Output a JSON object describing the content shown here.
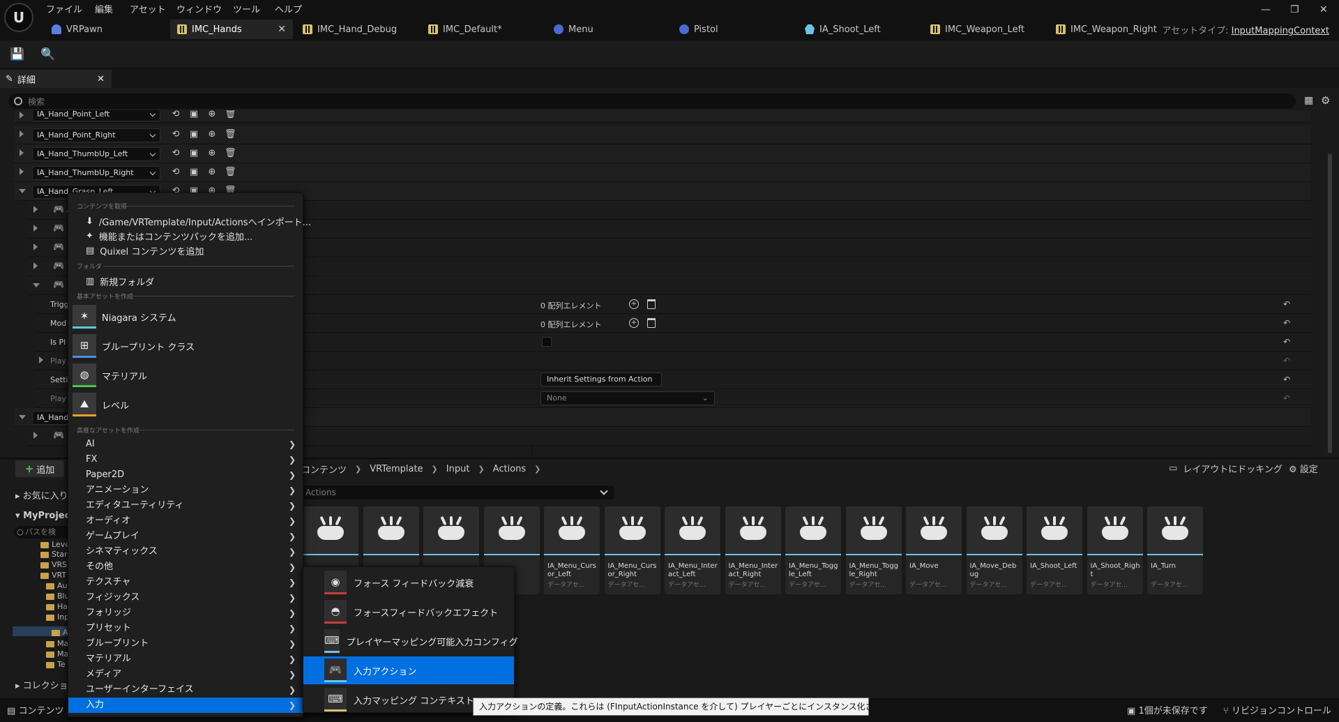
{
  "menubar": [
    "ファイル",
    "編集",
    "アセット",
    "ウィンドウ",
    "ツール",
    "ヘルプ"
  ],
  "tabs": [
    {
      "label": "VRPawn",
      "icon": "pawn-icon"
    },
    {
      "label": "IMC_Hands",
      "icon": "input-mapping-icon",
      "active": true
    },
    {
      "label": "IMC_Hand_Debug",
      "icon": "input-mapping-icon"
    },
    {
      "label": "IMC_Default*",
      "icon": "input-mapping-icon"
    },
    {
      "label": "Menu",
      "icon": "widget-icon"
    },
    {
      "label": "Pistol",
      "icon": "blueprint-icon"
    },
    {
      "label": "IA_Shoot_Left",
      "icon": "input-action-icon"
    },
    {
      "label": "IMC_Weapon_Left",
      "icon": "input-mapping-icon"
    },
    {
      "label": "IMC_Weapon_Right",
      "icon": "input-mapping-icon"
    }
  ],
  "asset_type": {
    "label": "アセットタイプ:",
    "value": "InputMappingContext"
  },
  "details": {
    "tab_label": "詳細",
    "search_placeholder": "検索",
    "mappings": [
      "IA_Hand_Point_Left",
      "IA_Hand_Point_Right",
      "IA_Hand_ThumbUp_Left",
      "IA_Hand_ThumbUp_Right",
      "IA_Hand_Grasp_Left",
      "IA_Hand_Grasp_Right"
    ],
    "sub_prefix": "Au",
    "props": [
      {
        "label": "Trigg",
        "value": "0 配列エレメント"
      },
      {
        "label": "Mod",
        "value": "0 配列エレメント"
      },
      {
        "label": "Is Pl",
        "value": ""
      },
      {
        "label": "Play",
        "value": ""
      },
      {
        "label": "Setti",
        "value": "Inherit Settings from Action"
      },
      {
        "label": "Play",
        "value": "None"
      }
    ]
  },
  "content_browser": {
    "add_label": "追加",
    "favorites_label": "お気に入り",
    "project_label": "MyProject",
    "path_search_placeholder": "パスを検",
    "collections_label": "コレクショ",
    "breadcrumb": [
      "コンテンツ",
      "VRTemplate",
      "Input",
      "Actions"
    ],
    "dock_label": "レイアウトにドッキング",
    "settings_label": "設定",
    "filter_placeholder": "Actions",
    "tree": [
      "Leve",
      "Star",
      "VRS",
      "VRT",
      "Au",
      "Blu",
      "Ha",
      "Inp",
      "A",
      "Ma",
      "Ma",
      "Te"
    ],
    "assets": [
      {
        "name": "",
        "type": ""
      },
      {
        "name": "",
        "type": ""
      },
      {
        "name": "",
        "type": ""
      },
      {
        "name": "",
        "type": ""
      },
      {
        "name": "IA_Menu_Cursor_Left",
        "type": "データアセ..."
      },
      {
        "name": "IA_Menu_Cursor_Right",
        "type": "データアセ..."
      },
      {
        "name": "IA_Menu_Interact_Left",
        "type": "データアセ..."
      },
      {
        "name": "IA_Menu_Interact_Right",
        "type": "データアセ..."
      },
      {
        "name": "IA_Menu_Toggle_Left",
        "type": "データアセ..."
      },
      {
        "name": "IA_Menu_Toggle_Right",
        "type": "データアセ..."
      },
      {
        "name": "IA_Move",
        "type": "データアセ..."
      },
      {
        "name": "IA_Move_Debug",
        "type": "データアセ..."
      },
      {
        "name": "IA_Shoot_Left",
        "type": "データアセ..."
      },
      {
        "name": "IA_Shoot_Right",
        "type": "データアセ..."
      },
      {
        "name": "IA_Turn",
        "type": "データアセ..."
      }
    ]
  },
  "context_menu": {
    "sec_get_content": "コンテンツを取得",
    "import_label": "/Game/VRTemplate/Input/Actionsへインポート...",
    "add_feature_label": "機能またはコンテンツパックを追加...",
    "quixel_label": "Quixel コンテンツを追加",
    "sec_folder": "フォルダ",
    "new_folder_label": "新規フォルダ",
    "sec_basic": "基本アセットを作成",
    "basic": [
      {
        "label": "Niagara システム",
        "color": "#5ac8e0"
      },
      {
        "label": "ブループリント クラス",
        "color": "#4a90e2"
      },
      {
        "label": "マテリアル",
        "color": "#4fc34f"
      },
      {
        "label": "レベル",
        "color": "#e8a030"
      }
    ],
    "sec_advanced": "高度なアセットを作成",
    "categories": [
      "AI",
      "FX",
      "Paper2D",
      "アニメーション",
      "エディタユーティリティ",
      "オーディオ",
      "ゲームプレイ",
      "シネマティックス",
      "その他",
      "テクスチャ",
      "フィジックス",
      "フォリッジ",
      "プリセット",
      "ブループリント",
      "マテリアル",
      "メディア",
      "ユーザーインターフェイス",
      "入力"
    ],
    "selected_category": "入力"
  },
  "submenu": {
    "items": [
      {
        "label": "フォース フィードバック減衰",
        "color": "#c83c3c"
      },
      {
        "label": "フォースフィードバックエフェクト",
        "color": "#c83c3c"
      },
      {
        "label": "プレイヤーマッピング可能入力コンフィグ",
        "color": "#6cc3e8"
      },
      {
        "label": "入力アクション",
        "color": "#6cc3e8"
      },
      {
        "label": "入力マッピング コンテキスト",
        "color": "#d8c26a"
      }
    ],
    "selected": "入力アクション"
  },
  "tooltip": "入力アクションの定義。これらは (FInputActionInstance を介して) プレイヤーごとにインスタンス化されます",
  "status": {
    "content_drawer": "コンテンツ",
    "unsaved": "1個が未保存です",
    "revision": "リビジョンコントロール"
  }
}
